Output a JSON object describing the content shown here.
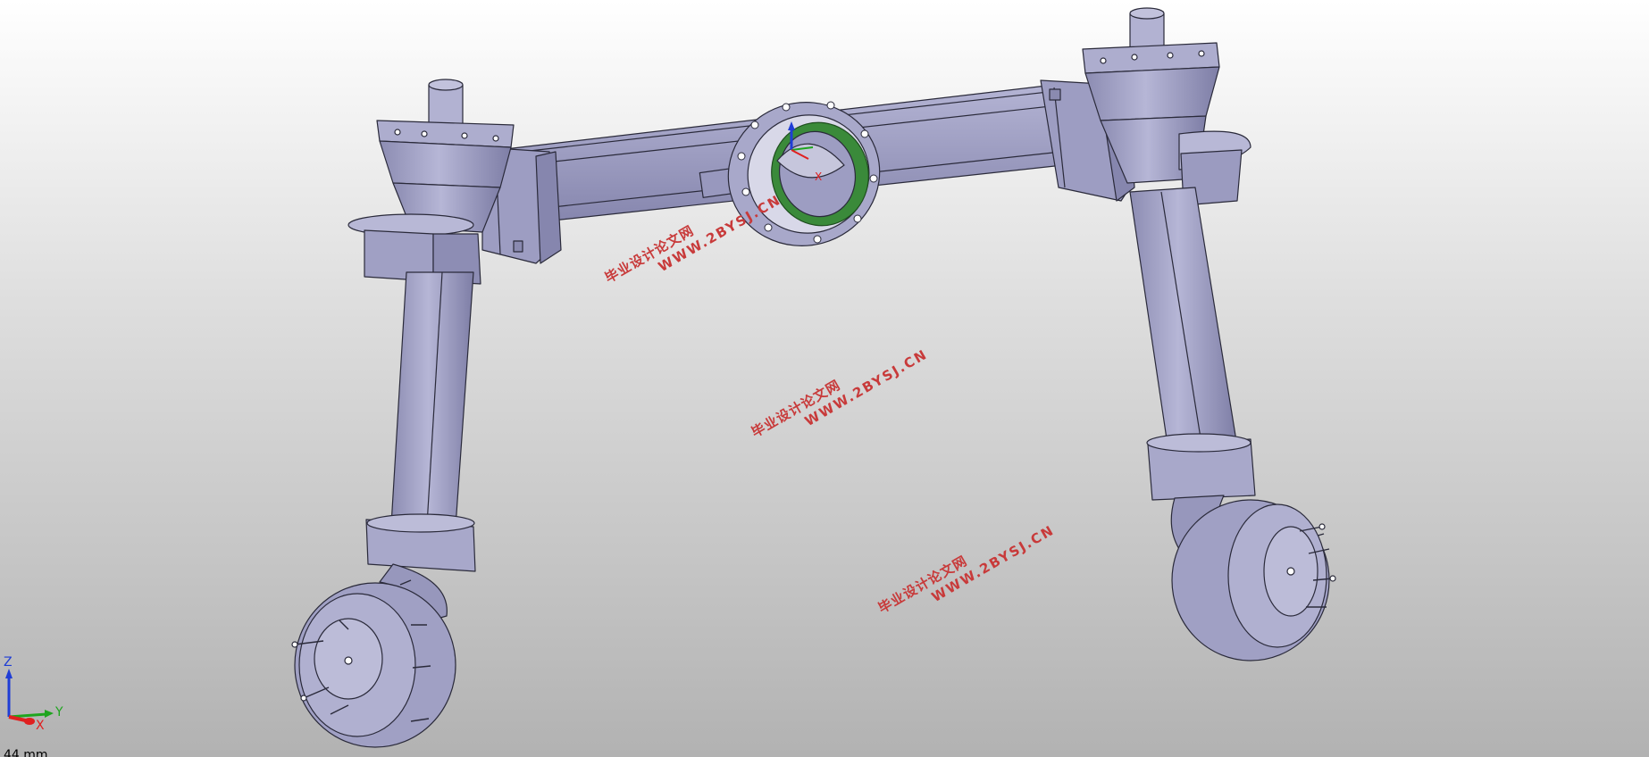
{
  "viewport": {
    "background_top": "#ffffff",
    "background_bottom": "#b2b2b2",
    "part_color": "#a3a3c6",
    "edge_color": "#2a2a3a",
    "gear_color": "#3a8a3a"
  },
  "watermarks": [
    {
      "line1": "毕业设计论文网",
      "line2": "WWW.2BYSJ.CN"
    },
    {
      "line1": "毕业设计论文网",
      "line2": "WWW.2BYSJ.CN"
    },
    {
      "line1": "毕业设计论文网",
      "line2": "WWW.2BYSJ.CN"
    }
  ],
  "local_triad": {
    "x_label": "X"
  },
  "axis_triad": {
    "z_label": "Z",
    "y_label": "Y",
    "x_label": "X",
    "z_color": "#1f3dd6",
    "y_color": "#1ea51e",
    "x_color": "#e02020"
  },
  "scale_text": "44 mm"
}
